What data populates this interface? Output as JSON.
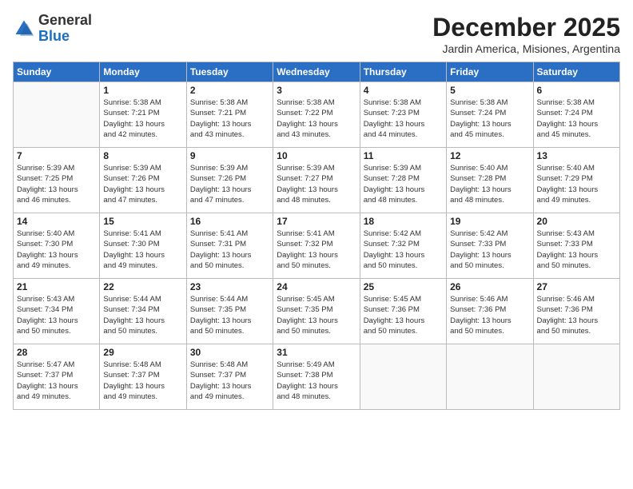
{
  "header": {
    "logo_general": "General",
    "logo_blue": "Blue",
    "month_title": "December 2025",
    "location": "Jardin America, Misiones, Argentina"
  },
  "days_of_week": [
    "Sunday",
    "Monday",
    "Tuesday",
    "Wednesday",
    "Thursday",
    "Friday",
    "Saturday"
  ],
  "weeks": [
    [
      {
        "day": "",
        "info": ""
      },
      {
        "day": "1",
        "info": "Sunrise: 5:38 AM\nSunset: 7:21 PM\nDaylight: 13 hours\nand 42 minutes."
      },
      {
        "day": "2",
        "info": "Sunrise: 5:38 AM\nSunset: 7:21 PM\nDaylight: 13 hours\nand 43 minutes."
      },
      {
        "day": "3",
        "info": "Sunrise: 5:38 AM\nSunset: 7:22 PM\nDaylight: 13 hours\nand 43 minutes."
      },
      {
        "day": "4",
        "info": "Sunrise: 5:38 AM\nSunset: 7:23 PM\nDaylight: 13 hours\nand 44 minutes."
      },
      {
        "day": "5",
        "info": "Sunrise: 5:38 AM\nSunset: 7:24 PM\nDaylight: 13 hours\nand 45 minutes."
      },
      {
        "day": "6",
        "info": "Sunrise: 5:38 AM\nSunset: 7:24 PM\nDaylight: 13 hours\nand 45 minutes."
      }
    ],
    [
      {
        "day": "7",
        "info": "Sunrise: 5:39 AM\nSunset: 7:25 PM\nDaylight: 13 hours\nand 46 minutes."
      },
      {
        "day": "8",
        "info": "Sunrise: 5:39 AM\nSunset: 7:26 PM\nDaylight: 13 hours\nand 47 minutes."
      },
      {
        "day": "9",
        "info": "Sunrise: 5:39 AM\nSunset: 7:26 PM\nDaylight: 13 hours\nand 47 minutes."
      },
      {
        "day": "10",
        "info": "Sunrise: 5:39 AM\nSunset: 7:27 PM\nDaylight: 13 hours\nand 48 minutes."
      },
      {
        "day": "11",
        "info": "Sunrise: 5:39 AM\nSunset: 7:28 PM\nDaylight: 13 hours\nand 48 minutes."
      },
      {
        "day": "12",
        "info": "Sunrise: 5:40 AM\nSunset: 7:28 PM\nDaylight: 13 hours\nand 48 minutes."
      },
      {
        "day": "13",
        "info": "Sunrise: 5:40 AM\nSunset: 7:29 PM\nDaylight: 13 hours\nand 49 minutes."
      }
    ],
    [
      {
        "day": "14",
        "info": "Sunrise: 5:40 AM\nSunset: 7:30 PM\nDaylight: 13 hours\nand 49 minutes."
      },
      {
        "day": "15",
        "info": "Sunrise: 5:41 AM\nSunset: 7:30 PM\nDaylight: 13 hours\nand 49 minutes."
      },
      {
        "day": "16",
        "info": "Sunrise: 5:41 AM\nSunset: 7:31 PM\nDaylight: 13 hours\nand 50 minutes."
      },
      {
        "day": "17",
        "info": "Sunrise: 5:41 AM\nSunset: 7:32 PM\nDaylight: 13 hours\nand 50 minutes."
      },
      {
        "day": "18",
        "info": "Sunrise: 5:42 AM\nSunset: 7:32 PM\nDaylight: 13 hours\nand 50 minutes."
      },
      {
        "day": "19",
        "info": "Sunrise: 5:42 AM\nSunset: 7:33 PM\nDaylight: 13 hours\nand 50 minutes."
      },
      {
        "day": "20",
        "info": "Sunrise: 5:43 AM\nSunset: 7:33 PM\nDaylight: 13 hours\nand 50 minutes."
      }
    ],
    [
      {
        "day": "21",
        "info": "Sunrise: 5:43 AM\nSunset: 7:34 PM\nDaylight: 13 hours\nand 50 minutes."
      },
      {
        "day": "22",
        "info": "Sunrise: 5:44 AM\nSunset: 7:34 PM\nDaylight: 13 hours\nand 50 minutes."
      },
      {
        "day": "23",
        "info": "Sunrise: 5:44 AM\nSunset: 7:35 PM\nDaylight: 13 hours\nand 50 minutes."
      },
      {
        "day": "24",
        "info": "Sunrise: 5:45 AM\nSunset: 7:35 PM\nDaylight: 13 hours\nand 50 minutes."
      },
      {
        "day": "25",
        "info": "Sunrise: 5:45 AM\nSunset: 7:36 PM\nDaylight: 13 hours\nand 50 minutes."
      },
      {
        "day": "26",
        "info": "Sunrise: 5:46 AM\nSunset: 7:36 PM\nDaylight: 13 hours\nand 50 minutes."
      },
      {
        "day": "27",
        "info": "Sunrise: 5:46 AM\nSunset: 7:36 PM\nDaylight: 13 hours\nand 50 minutes."
      }
    ],
    [
      {
        "day": "28",
        "info": "Sunrise: 5:47 AM\nSunset: 7:37 PM\nDaylight: 13 hours\nand 49 minutes."
      },
      {
        "day": "29",
        "info": "Sunrise: 5:48 AM\nSunset: 7:37 PM\nDaylight: 13 hours\nand 49 minutes."
      },
      {
        "day": "30",
        "info": "Sunrise: 5:48 AM\nSunset: 7:37 PM\nDaylight: 13 hours\nand 49 minutes."
      },
      {
        "day": "31",
        "info": "Sunrise: 5:49 AM\nSunset: 7:38 PM\nDaylight: 13 hours\nand 48 minutes."
      },
      {
        "day": "",
        "info": ""
      },
      {
        "day": "",
        "info": ""
      },
      {
        "day": "",
        "info": ""
      }
    ]
  ]
}
